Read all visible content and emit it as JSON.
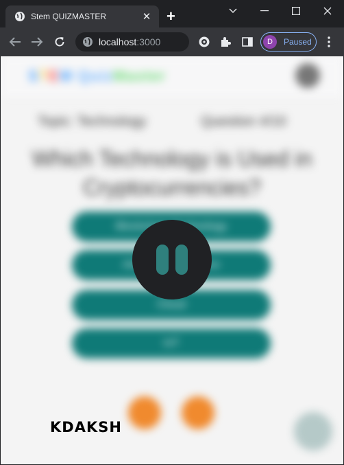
{
  "browser": {
    "tab": {
      "title": "Stem QUIZMASTER",
      "close_glyph": "✕",
      "favicon": "globe-icon"
    },
    "new_tab_glyph": "+",
    "window_controls": {
      "dropdown": "chevron-down-icon",
      "minimize": "minimize-icon",
      "maximize": "maximize-icon",
      "close": "close-icon"
    },
    "toolbar": {
      "url_host": "localhost",
      "url_port": ":3000",
      "profile_initial": "D",
      "profile_label": "Paused"
    }
  },
  "page": {
    "logo_parts": [
      "S",
      "T",
      "E",
      "M",
      " ",
      "Quiz",
      "Master"
    ],
    "meta_left": "Topic: Technology",
    "meta_right": "Question 4/10",
    "question": "Which Technology is Used in Cryptocurrencies?",
    "options": [
      "Blockchain Technology",
      "Artificial Intelligence",
      "Cloud",
      "IoT"
    ],
    "watermark": "KDAKSH",
    "colors": {
      "option_bg": "#0f7a77",
      "nav_button": "#f08a2e",
      "page_bg": "#f4f4f4"
    }
  },
  "overlay": {
    "state": "paused",
    "icon": "pause-icon"
  }
}
